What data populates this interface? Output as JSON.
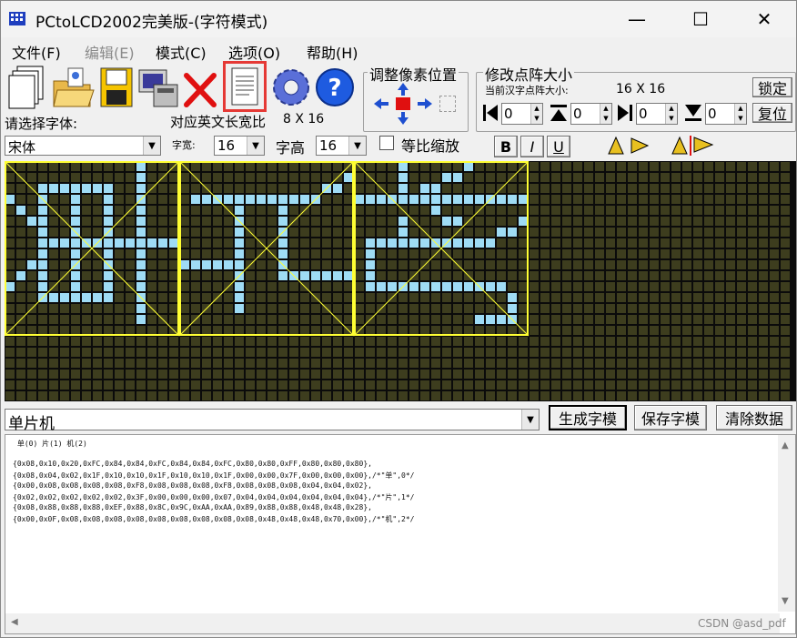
{
  "window": {
    "title": "PCtoLCD2002完美版-(字符模式)",
    "minimize": "—",
    "maximize": "☐",
    "close": "✕"
  },
  "menu": [
    {
      "label": "文件(F)",
      "enabled": true
    },
    {
      "label": "编辑(E)",
      "enabled": false
    },
    {
      "label": "模式(C)",
      "enabled": true
    },
    {
      "label": "选项(O)",
      "enabled": true
    },
    {
      "label": "帮助(H)",
      "enabled": true
    }
  ],
  "pixel_adjust": {
    "title": "调整像素位置"
  },
  "dot_matrix": {
    "title": "修改点阵大小",
    "current_label": "当前汉字点阵大小:",
    "current_value": "16 X 16",
    "lock_button": "锁定",
    "reset_button": "复位",
    "spinners": [
      "0",
      "0",
      "0",
      "0"
    ]
  },
  "font": {
    "choose_label": "请选择字体:",
    "ratio_label": "对应英文长宽比",
    "ratio_value": "8 X 16",
    "font_name": "宋体",
    "width_label": "字宽:",
    "width_value": "16",
    "height_label": "字高",
    "height_value": "16",
    "proportional_label": "等比缩放",
    "bold": "B",
    "italic": "I",
    "underline": "U"
  },
  "input": {
    "text": "单片机",
    "generate_button": "生成字模",
    "save_button": "保存字模",
    "clear_button": "清除数据"
  },
  "output": {
    "lines": [
      " 单(0) 片(1) 机(2)",
      "",
      "{0x08,0x10,0x20,0xFC,0x84,0x84,0xFC,0x84,0x84,0xFC,0x80,0x80,0xFF,0x80,0x80,0x80},",
      "{0x08,0x04,0x02,0x1F,0x10,0x10,0x1F,0x10,0x10,0x1F,0x00,0x00,0x7F,0x00,0x00,0x00},/*\"单\",0*/",
      "{0x00,0x08,0x08,0x08,0x08,0xF8,0x08,0x08,0x08,0xF8,0x08,0x08,0x08,0x04,0x04,0x02},",
      "{0x02,0x02,0x02,0x02,0x02,0x3F,0x00,0x00,0x00,0x07,0x04,0x04,0x04,0x04,0x04,0x04},/*\"片\",1*/",
      "{0x08,0x88,0x88,0x88,0xEF,0x88,0x8C,0x9C,0xAA,0xAA,0x89,0x88,0x88,0x48,0x48,0x28},",
      "{0x00,0x0F,0x08,0x08,0x08,0x08,0x08,0x08,0x08,0x08,0x08,0x48,0x48,0x48,0x70,0x00},/*\"机\",2*/"
    ]
  },
  "colors": {
    "grid_bg": "#3d3d1e",
    "grid_line": "#0b0b0b",
    "pixel_on": "#9fdcf5",
    "frame": "#ffff33",
    "highlight": "#e53935"
  },
  "watermark": "CSDN @asd_pdf"
}
